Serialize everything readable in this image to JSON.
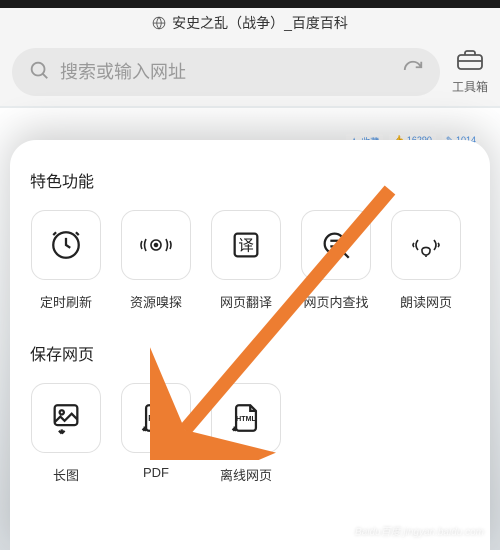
{
  "tab": {
    "title": "安史之乱（战争）_百度百科"
  },
  "search": {
    "placeholder": "搜索或输入网址"
  },
  "toolbox": {
    "label": "工具箱"
  },
  "badges": {
    "b1": "★ 收藏",
    "b2": "👍 16290",
    "b3": "✎ 1014"
  },
  "sheet": {
    "section1": {
      "title": "特色功能",
      "tiles": [
        {
          "label": "定时刷新"
        },
        {
          "label": "资源嗅探"
        },
        {
          "label": "网页翻译"
        },
        {
          "label": "网页内查找"
        },
        {
          "label": "朗读网页"
        }
      ]
    },
    "section2": {
      "title": "保存网页",
      "tiles": [
        {
          "label": "长图"
        },
        {
          "label": "PDF"
        },
        {
          "label": "离线网页"
        }
      ]
    }
  },
  "watermark": "Baidu百度 jingyan.baidu.com"
}
